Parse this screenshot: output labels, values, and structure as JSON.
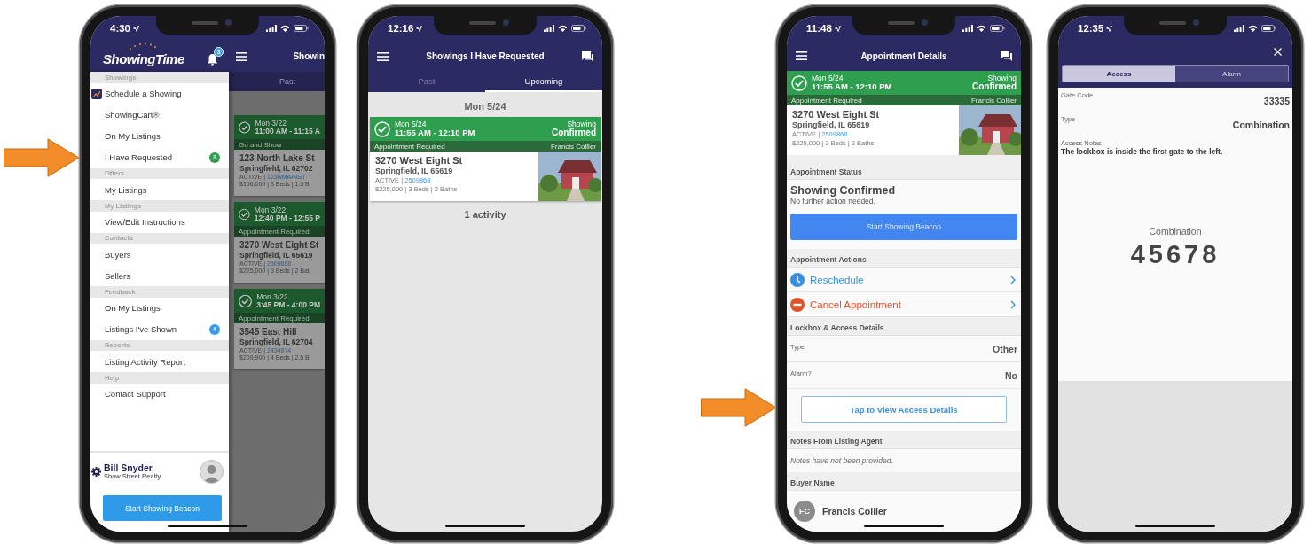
{
  "menu_screen": {
    "status_time": "4:30",
    "brand": "ShowingTime",
    "notification_count": "3",
    "screen_title": "Showin",
    "background_tab": "Past",
    "menu": [
      {
        "header": "Showings",
        "items": [
          {
            "label": "Schedule a Showing",
            "kind": "icon"
          },
          {
            "label": "ShowingCart®",
            "kind": "plain"
          },
          {
            "label": "On My Listings",
            "kind": "plain"
          },
          {
            "label": "I Have Requested",
            "kind": "badge",
            "badge": "3",
            "color": "#2e9e4f"
          }
        ]
      },
      {
        "header": "Offers",
        "items": [
          {
            "label": "My Listings",
            "kind": "plain"
          }
        ]
      },
      {
        "header": "My Listings",
        "items": [
          {
            "label": "View/Edit Instructions",
            "kind": "plain"
          }
        ]
      },
      {
        "header": "Contacts",
        "items": [
          {
            "label": "Buyers",
            "kind": "plain"
          },
          {
            "label": "Sellers",
            "kind": "plain"
          }
        ]
      },
      {
        "header": "Feedback",
        "items": [
          {
            "label": "On My Listings",
            "kind": "plain"
          },
          {
            "label": "Listings I've Shown",
            "kind": "badge",
            "badge": "4",
            "color": "#3a9be8"
          }
        ]
      },
      {
        "header": "Reports",
        "items": [
          {
            "label": "Listing Activity Report",
            "kind": "plain"
          }
        ]
      },
      {
        "header": "Help",
        "items": [
          {
            "label": "Contact Support",
            "kind": "plain"
          }
        ]
      }
    ],
    "user": {
      "name": "Bill Snyder",
      "company": "Show Street Realty"
    },
    "beacon_button": "Start Showing Beacon",
    "cards": [
      {
        "date": "Mon 3/22",
        "time": "11:00 AM - 11:15 A",
        "requirement": "Go and Show",
        "address": "123 North Lake St",
        "city": "Springfield, IL 62702",
        "status": "ACTIVE |",
        "mls": "123NMAINST",
        "details": "$156,000 | 3 Beds | 1.5 B"
      },
      {
        "date": "Mon 3/22",
        "time": "12:40 PM - 12:55 P",
        "requirement": "Appointment Required",
        "address": "3270 West Eight St",
        "city": "Springfield, IL 65619",
        "status": "ACTIVE |",
        "mls": "2509868",
        "details": "$225,000 | 3 Beds | 2 Bat"
      },
      {
        "date": "Mon 3/22",
        "time": "3:45 PM - 4:00 PM",
        "requirement": "Appointment Required",
        "address": "3545 East Hill",
        "city": "Springfield, IL 62704",
        "status": "ACTIVE |",
        "mls": "2434974",
        "details": "$209,900 | 4 Beds | 2.5 B"
      }
    ]
  },
  "requested_screen": {
    "status_time": "12:16",
    "title": "Showings I Have Requested",
    "tabs": [
      {
        "label": "Past",
        "selected": false
      },
      {
        "label": "Upcoming",
        "selected": true
      }
    ],
    "date_header": "Mon 5/24",
    "cards": [
      {
        "date": "Mon 5/24",
        "time": "11:55 AM - 12:10 PM",
        "status_label": "Showing",
        "status_value": "Confirmed",
        "requirement": "Appointment Required",
        "agent": "Francis Collier",
        "address": "3270 West Eight St",
        "city": "Springfield, IL 65619",
        "status": "ACTIVE |",
        "mls": "2509868",
        "details": "$225,000 | 3 Beds | 2 Baths"
      }
    ],
    "summary": "1 activity"
  },
  "details_screen": {
    "status_time": "11:48",
    "title": "Appointment Details",
    "card": {
      "date": "Mon 5/24",
      "time": "11:55 AM - 12:10 PM",
      "status_label": "Showing",
      "status_value": "Confirmed",
      "requirement": "Appointment Required",
      "agent": "Francis Collier",
      "address": "3270 West Eight St",
      "city": "Springfield, IL 65619",
      "status": "ACTIVE |",
      "mls": "2509868",
      "details": "$225,000 | 3 Beds | 2 Baths"
    },
    "status_section": {
      "header": "Appointment Status",
      "title": "Showing Confirmed",
      "subtitle": "No further action needed.",
      "button": "Start Showing Beacon"
    },
    "actions_section": {
      "header": "Appointment Actions",
      "actions": [
        {
          "label": "Reschedule",
          "kind": "reschedule"
        },
        {
          "label": "Cancel Appointment",
          "kind": "cancel"
        }
      ]
    },
    "lockbox_section": {
      "header": "Lockbox & Access Details",
      "rows": [
        {
          "label": "Type",
          "value": "Other"
        },
        {
          "label": "Alarm?",
          "value": "No"
        }
      ],
      "button": "Tap to View Access Details"
    },
    "notes_section": {
      "header": "Notes From Listing Agent",
      "text": "Notes have not been provided."
    },
    "buyer_section": {
      "header": "Buyer Name",
      "initials": "FC",
      "name": "Francis Collier"
    }
  },
  "access_screen": {
    "status_time": "12:35",
    "tabs": [
      {
        "label": "Access",
        "selected": true
      },
      {
        "label": "Alarm",
        "selected": false
      }
    ],
    "rows": [
      {
        "label": "Gate Code",
        "value": "33335"
      },
      {
        "label": "Type",
        "value": "Combination"
      }
    ],
    "notes_label": "Access Notes",
    "notes": "The lockbox is inside the first gate to the left.",
    "code_label": "Combination",
    "code": "45678"
  }
}
